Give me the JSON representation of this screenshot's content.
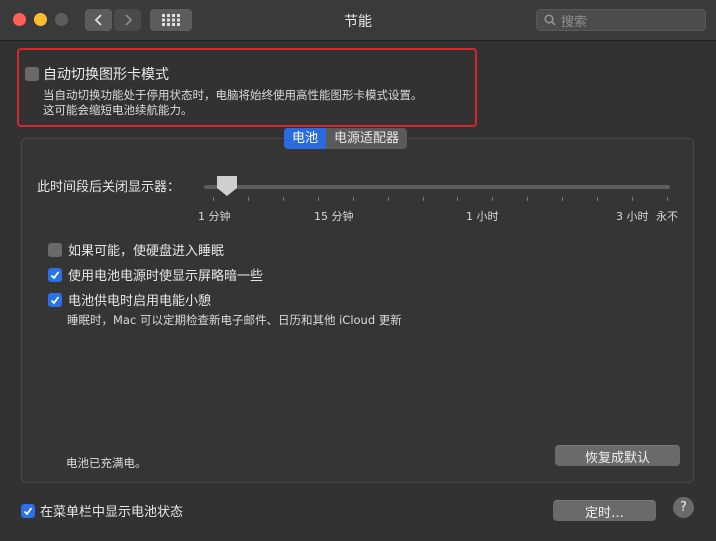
{
  "window": {
    "title": "节能",
    "search_placeholder": "搜索"
  },
  "graphics_switching": {
    "checked": false,
    "label": "自动切换图形卡模式",
    "description_line1": "当自动切换功能处于停用状态时，电脑将始终使用高性能图形卡模式设置。",
    "description_line2": "这可能会缩短电池续航能力。"
  },
  "tabs": [
    {
      "label": "电池",
      "selected": true
    },
    {
      "label": "电源适配器",
      "selected": false
    }
  ],
  "display_sleep": {
    "label": "此时间段后关闭显示器：",
    "ticks": [
      "1 分钟",
      "15 分钟",
      "1 小时",
      "3 小时",
      "永不"
    ],
    "value": "1 分钟"
  },
  "options": [
    {
      "label": "如果可能，使硬盘进入睡眠",
      "checked": false
    },
    {
      "label": "使用电池电源时使显示屏略暗一些",
      "checked": true
    },
    {
      "label": "电池供电时启用电能小憩",
      "checked": true
    }
  ],
  "power_nap_note": "睡眠时，Mac 可以定期检查新电子邮件、日历和其他 iCloud 更新",
  "battery_status": "电池已充满电。",
  "buttons": {
    "restore_defaults": "恢复成默认",
    "schedule": "定时…",
    "help": "?"
  },
  "show_in_menubar": {
    "label": "在菜单栏中显示电池状态",
    "checked": true
  },
  "colors": {
    "accent": "#2a6be0",
    "highlight_border": "#d8262d"
  }
}
